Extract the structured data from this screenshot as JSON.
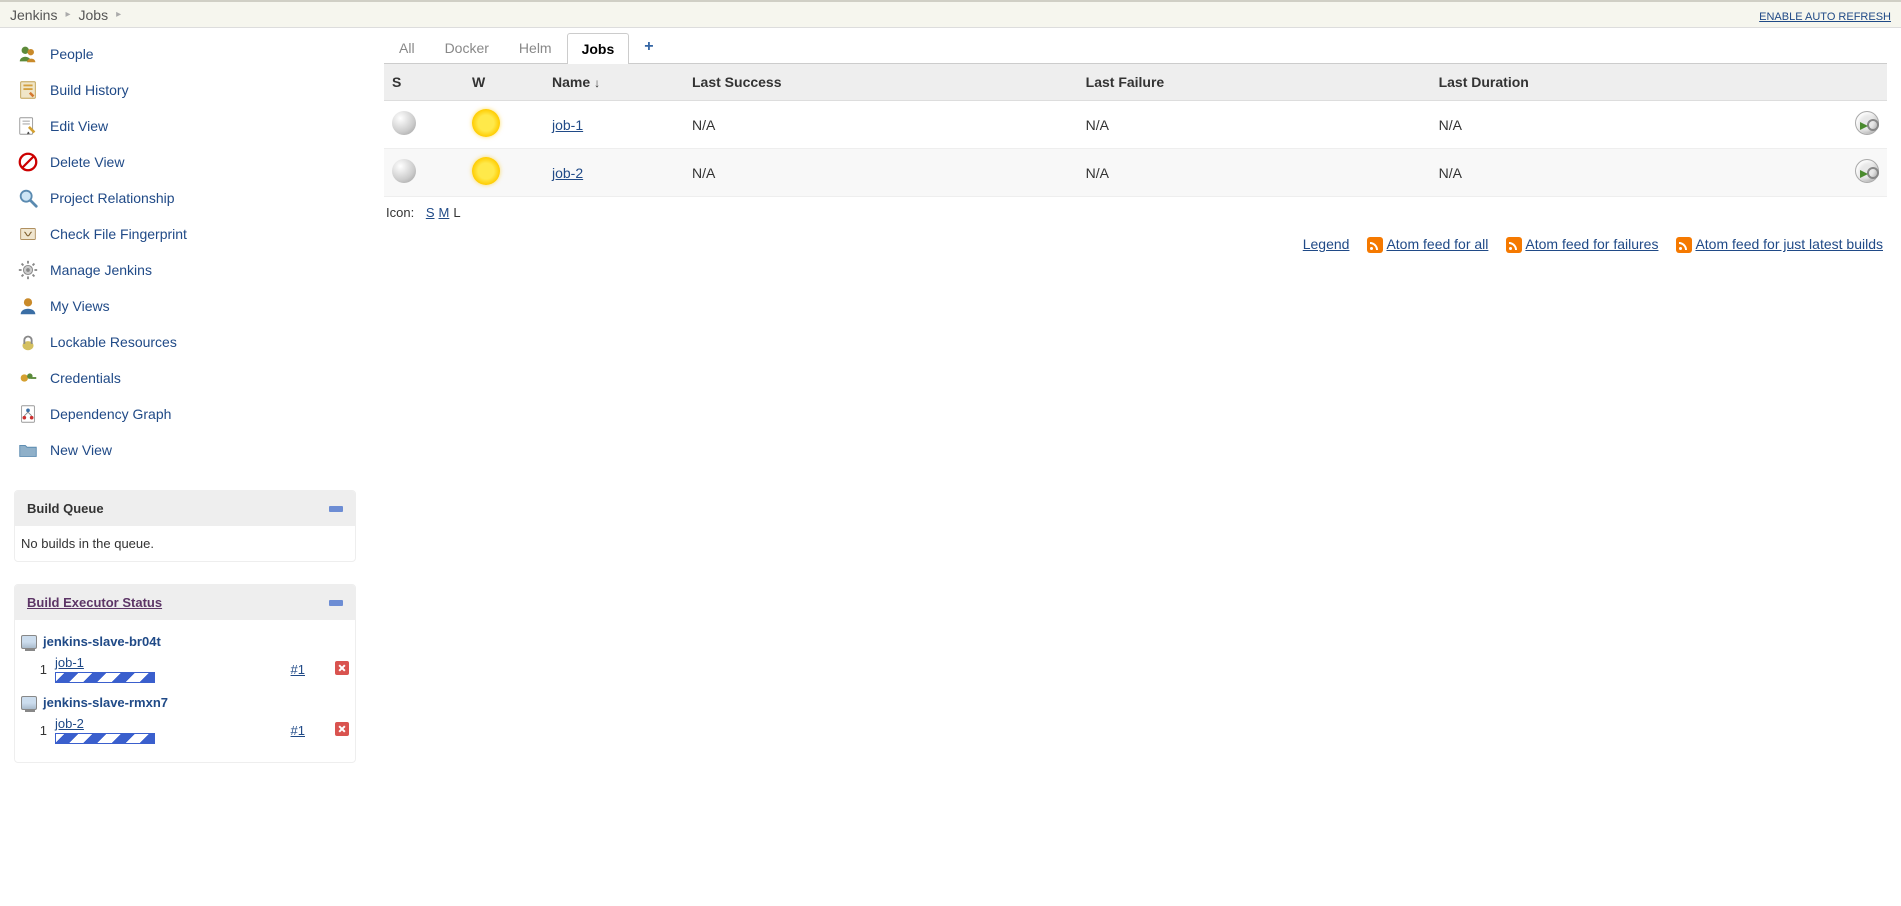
{
  "breadcrumbs": {
    "items": [
      "Jenkins",
      "Jobs"
    ],
    "autorefresh": "ENABLE AUTO REFRESH"
  },
  "sidebar": {
    "nav": [
      {
        "label": "People"
      },
      {
        "label": "Build History"
      },
      {
        "label": "Edit View"
      },
      {
        "label": "Delete View"
      },
      {
        "label": "Project Relationship"
      },
      {
        "label": "Check File Fingerprint"
      },
      {
        "label": "Manage Jenkins"
      },
      {
        "label": "My Views"
      },
      {
        "label": "Lockable Resources"
      },
      {
        "label": "Credentials"
      },
      {
        "label": "Dependency Graph"
      },
      {
        "label": "New View"
      }
    ],
    "build_queue": {
      "title": "Build Queue",
      "empty": "No builds in the queue."
    },
    "executor": {
      "title": "Build Executor Status",
      "nodes": [
        {
          "name": "jenkins-slave-br04t",
          "slot": "1",
          "job": "job-1",
          "build": "#1"
        },
        {
          "name": "jenkins-slave-rmxn7",
          "slot": "1",
          "job": "job-2",
          "build": "#1"
        }
      ]
    }
  },
  "tabs": [
    "All",
    "Docker",
    "Helm",
    "Jobs"
  ],
  "tabs_add": "+",
  "table": {
    "headers": {
      "s": "S",
      "w": "W",
      "name": "Name",
      "sort": "↓",
      "last_success": "Last Success",
      "last_failure": "Last Failure",
      "last_duration": "Last Duration"
    },
    "rows": [
      {
        "name": "job-1",
        "last_success": "N/A",
        "last_failure": "N/A",
        "last_duration": "N/A"
      },
      {
        "name": "job-2",
        "last_success": "N/A",
        "last_failure": "N/A",
        "last_duration": "N/A"
      }
    ]
  },
  "iconrow": {
    "label": "Icon:",
    "s": "S",
    "m": "M",
    "l": "L"
  },
  "footer": {
    "legend": "Legend",
    "feed_all": "Atom feed for all",
    "feed_failures": "Atom feed for failures",
    "feed_latest": "Atom feed for just latest builds"
  }
}
